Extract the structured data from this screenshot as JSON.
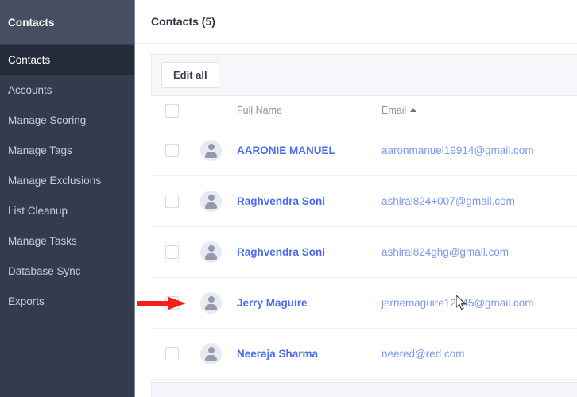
{
  "sidebar": {
    "header_title": "Contacts",
    "items": [
      {
        "label": "Contacts",
        "active": true
      },
      {
        "label": "Accounts",
        "active": false
      },
      {
        "label": "Manage Scoring",
        "active": false
      },
      {
        "label": "Manage Tags",
        "active": false
      },
      {
        "label": "Manage Exclusions",
        "active": false
      },
      {
        "label": "List Cleanup",
        "active": false
      },
      {
        "label": "Manage Tasks",
        "active": false
      },
      {
        "label": "Database Sync",
        "active": false
      },
      {
        "label": "Exports",
        "active": false
      }
    ]
  },
  "header": {
    "title": "Contacts (5)",
    "count": 5
  },
  "toolbar": {
    "edit_all_label": "Edit all"
  },
  "table": {
    "columns": [
      {
        "key": "checkbox",
        "label": ""
      },
      {
        "key": "avatar",
        "label": ""
      },
      {
        "key": "full_name",
        "label": "Full Name"
      },
      {
        "key": "email",
        "label": "Email",
        "sorted": "asc",
        "sort_icon": "caret-up-icon"
      }
    ],
    "rows": [
      {
        "full_name": "AARONIE MANUEL",
        "email": "aaronmanuel19914@gmail.com",
        "checked": false,
        "avatar_icon": "person-icon"
      },
      {
        "full_name": "Raghvendra Soni",
        "email": "ashirai824+007@gmail.com",
        "checked": false,
        "avatar_icon": "person-icon"
      },
      {
        "full_name": "Raghvendra Soni",
        "email": "ashirai824ghg@gmail.com",
        "checked": false,
        "avatar_icon": "person-icon"
      },
      {
        "full_name": "Jerry Maguire",
        "email": "jerriemaguire12345@gmail.com",
        "checked": false,
        "avatar_icon": "person-icon"
      },
      {
        "full_name": "Neeraja Sharma",
        "email": "neered@red.com",
        "checked": false,
        "avatar_icon": "person-icon"
      }
    ]
  },
  "annotation": {
    "arrow_color": "#f51f1f",
    "points_to_row_index": 3,
    "points_to": "row-checkbox"
  },
  "colors": {
    "sidebar_bg": "#353b4e",
    "sidebar_header_bg": "#474e62",
    "sidebar_active_bg": "#262b39",
    "name_link": "#4a6df0",
    "email_link": "#7f98ee",
    "panel_bg": "#f6f7fb"
  }
}
